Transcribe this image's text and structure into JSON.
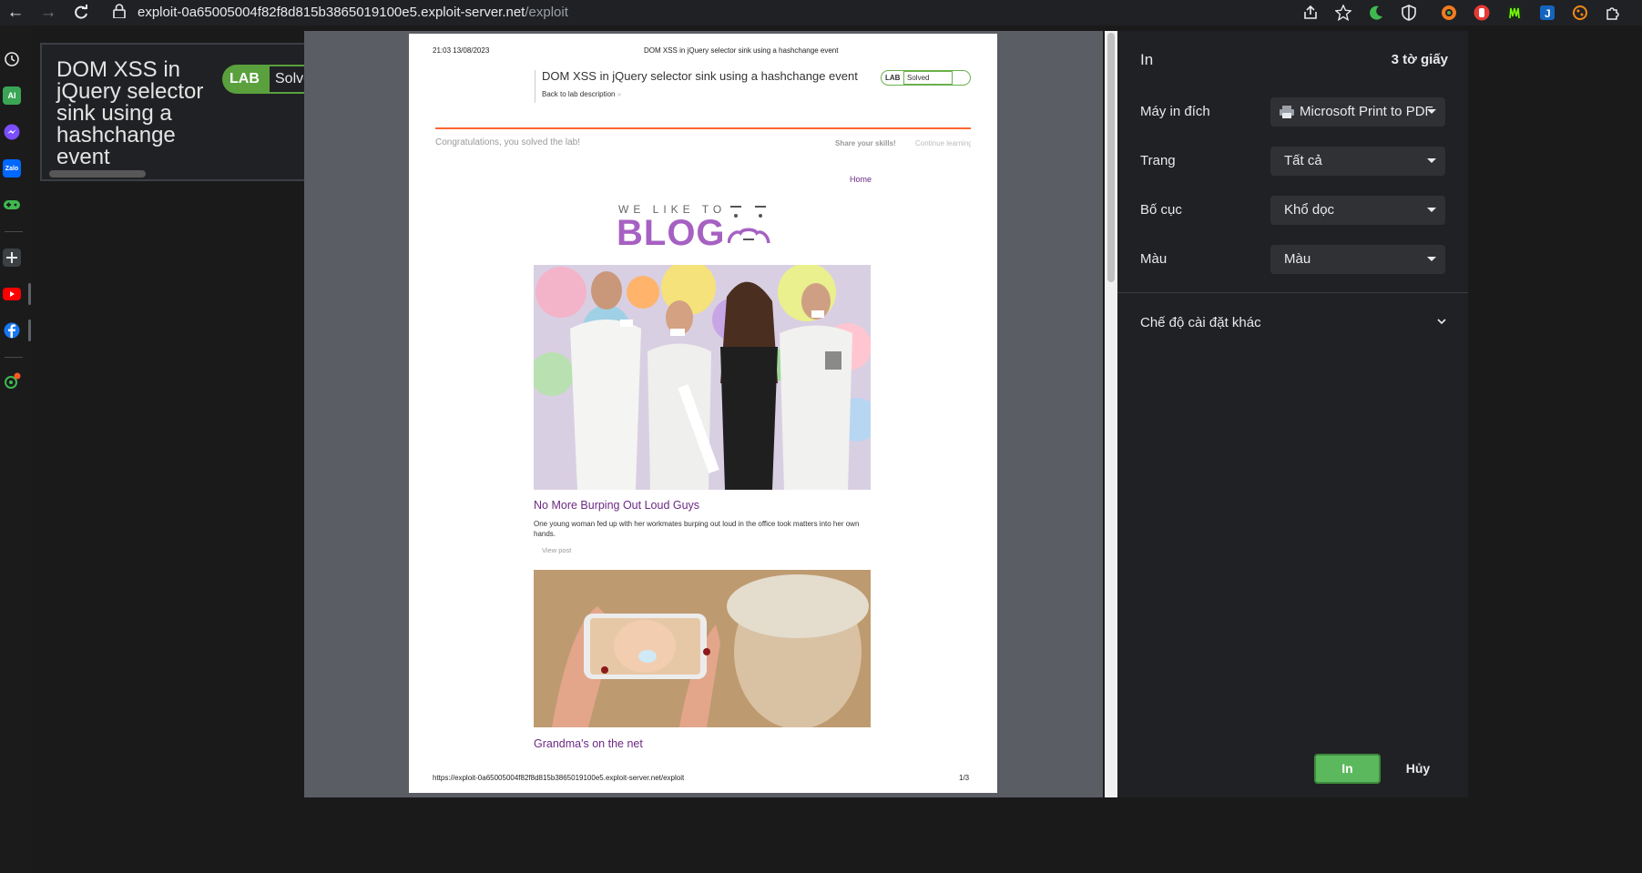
{
  "browser": {
    "url_host": "exploit-0a65005004f82f8d815b3865019100e5.exploit-server.net",
    "url_path": "/exploit"
  },
  "sidebar": {
    "items": [
      {
        "icon": "history-icon",
        "text": ""
      },
      {
        "icon": "ai-icon",
        "text": "AI"
      },
      {
        "icon": "messenger-icon",
        "text": ""
      },
      {
        "icon": "zalo-icon",
        "text": "Zalo"
      },
      {
        "icon": "gamepad-icon",
        "text": ""
      },
      {
        "icon": "add-icon",
        "text": ""
      },
      {
        "icon": "youtube-icon",
        "text": ""
      },
      {
        "icon": "facebook-icon",
        "text": ""
      },
      {
        "icon": "settings-icon",
        "text": ""
      }
    ]
  },
  "lab_card": {
    "title": "DOM XSS in jQuery selector sink using a hashchange event",
    "badge_lab": "LAB",
    "badge_status": "Solved"
  },
  "preview": {
    "header_datetime": "21:03 13/08/2023",
    "header_title": "DOM XSS in jQuery selector sink using a hashchange event",
    "lab_name": "DOM XSS in jQuery selector sink using a hashchange event",
    "back_link": "Back to lab description",
    "back_chevron": "»",
    "badge_lab": "LAB",
    "badge_status": "Solved",
    "congrats": "Congratulations, you solved the lab!",
    "share": "Share your skills!",
    "continue": "Continue learning",
    "home": "Home",
    "logo_top": "WE LIKE TO",
    "logo_main": "BLOG",
    "posts": [
      {
        "title": "No More Burping Out Loud Guys",
        "desc": "One young woman fed up with her workmates burping out loud in the office took matters into her own hands.",
        "view": "View post"
      },
      {
        "title": "Grandma's on the net"
      }
    ],
    "footer_url": "https://exploit-0a65005004f82f8d815b3865019100e5.exploit-server.net/exploit",
    "footer_page": "1/3"
  },
  "print_settings": {
    "title": "In",
    "sheets": "3 tờ giấy",
    "fields": [
      {
        "label": "Máy in đích",
        "value": "Microsoft Print to PDF"
      },
      {
        "label": "Trang",
        "value": "Tất cả"
      },
      {
        "label": "Bố cục",
        "value": "Khổ dọc"
      },
      {
        "label": "Màu",
        "value": "Màu"
      }
    ],
    "more_settings": "Chế độ cài đặt khác",
    "print_button": "In",
    "cancel_button": "Hủy"
  },
  "colors": {
    "accent_green": "#5cb85c",
    "blog_purple": "#a661c2",
    "link_purple": "#6c2a85",
    "lab_orange": "#ff6633"
  }
}
